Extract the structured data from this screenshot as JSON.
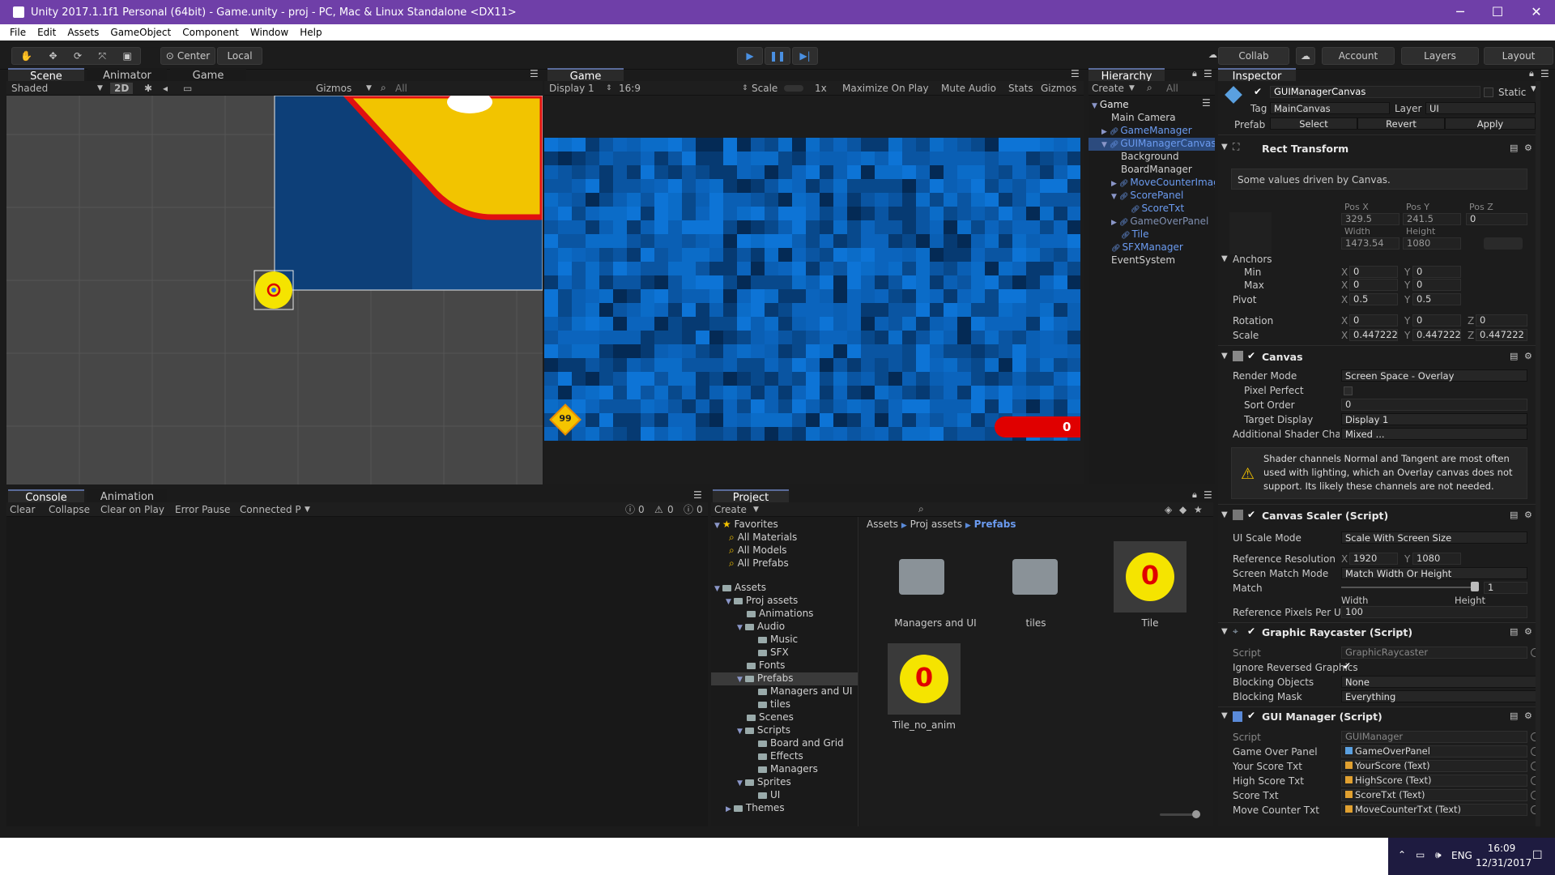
{
  "window": {
    "title": "Unity 2017.1.1f1 Personal (64bit) - Game.unity - proj - PC, Mac & Linux Standalone <DX11>",
    "minimize": "─",
    "maximize": "☐",
    "close": "✕"
  },
  "menu": [
    "File",
    "Edit",
    "Assets",
    "GameObject",
    "Component",
    "Window",
    "Help"
  ],
  "toolbar": {
    "tools": [
      "hand-icon",
      "move-icon",
      "rotate-icon",
      "scale-icon",
      "rect-icon"
    ],
    "center_label": "Center",
    "local_label": "Local",
    "play_controls": [
      "play-icon",
      "pause-icon",
      "step-icon"
    ],
    "collab_label": "Collab",
    "account_label": "Account",
    "layers_label": "Layers",
    "layout_label": "Layout"
  },
  "scene": {
    "tabs": [
      "Scene",
      "Animator",
      "Game"
    ],
    "shaded": "Shaded",
    "mode_2d": "2D",
    "gizmos": "Gizmos",
    "search_placeholder": "All"
  },
  "game": {
    "tab": "Game",
    "display": "Display 1",
    "aspect": "16:9",
    "scale_label": "Scale",
    "scale_value": "1x",
    "maximize": "Maximize On Play",
    "mute": "Mute Audio",
    "stats": "Stats",
    "gizmos": "Gizmos",
    "moves_counter": "99",
    "score": "0"
  },
  "hierarchy": {
    "tab": "Hierarchy",
    "create": "Create",
    "search_placeholder": "All",
    "items": [
      {
        "label": "Game",
        "indent": 0,
        "arrow": "▼",
        "prefab": false
      },
      {
        "label": "Main Camera",
        "indent": 1,
        "arrow": "",
        "prefab": false
      },
      {
        "label": "GameManager",
        "indent": 1,
        "arrow": "▶",
        "prefab": true
      },
      {
        "label": "GUIManagerCanvas",
        "indent": 1,
        "arrow": "▼",
        "prefab": true,
        "selected": true
      },
      {
        "label": "Background",
        "indent": 2,
        "arrow": "",
        "prefab": false
      },
      {
        "label": "BoardManager",
        "indent": 2,
        "arrow": "",
        "prefab": false
      },
      {
        "label": "MoveCounterImag",
        "indent": 2,
        "arrow": "▶",
        "prefab": true
      },
      {
        "label": "ScorePanel",
        "indent": 2,
        "arrow": "▼",
        "prefab": true
      },
      {
        "label": "ScoreTxt",
        "indent": 3,
        "arrow": "",
        "prefab": true
      },
      {
        "label": "GameOverPanel",
        "indent": 2,
        "arrow": "▶",
        "prefab": true,
        "dim": true
      },
      {
        "label": "Tile",
        "indent": 2,
        "arrow": "",
        "prefab": true
      },
      {
        "label": "SFXManager",
        "indent": 1,
        "arrow": "",
        "prefab": true
      },
      {
        "label": "EventSystem",
        "indent": 1,
        "arrow": "",
        "prefab": false
      }
    ]
  },
  "inspector": {
    "tab": "Inspector",
    "object_name": "GUIManagerCanvas",
    "static_label": "Static",
    "tag_label": "Tag",
    "tag_value": "MainCanvas",
    "layer_label": "Layer",
    "layer_value": "UI",
    "prefab_label": "Prefab",
    "prefab_select": "Select",
    "prefab_revert": "Revert",
    "prefab_apply": "Apply",
    "rect_transform": {
      "title": "Rect Transform",
      "note": "Some values driven by Canvas.",
      "pos_x_label": "Pos X",
      "pos_y_label": "Pos Y",
      "pos_z_label": "Pos Z",
      "pos_x": "329.5",
      "pos_y": "241.5",
      "pos_z": "0",
      "width_label": "Width",
      "height_label": "Height",
      "width": "1473.54",
      "height": "1080",
      "anchors_label": "Anchors",
      "min_label": "Min",
      "max_label": "Max",
      "min_x": "0",
      "min_y": "0",
      "max_x": "0",
      "max_y": "0",
      "pivot_label": "Pivot",
      "pivot_x": "0.5",
      "pivot_y": "0.5",
      "rotation_label": "Rotation",
      "rot_x": "0",
      "rot_y": "0",
      "rot_z": "0",
      "scale_label": "Scale",
      "scale_x": "0.447222",
      "scale_y": "0.447222",
      "scale_z": "0.447222"
    },
    "canvas": {
      "title": "Canvas",
      "render_mode_label": "Render Mode",
      "render_mode": "Screen Space - Overlay",
      "pixel_perfect_label": "Pixel Perfect",
      "sort_order_label": "Sort Order",
      "sort_order": "0",
      "target_display_label": "Target Display",
      "target_display": "Display 1",
      "shader_channels_label": "Additional Shader Chann",
      "shader_channels": "Mixed ...",
      "warning": "Shader channels Normal and Tangent are most often used with lighting, which an Overlay canvas does not support. Its likely these channels are not needed."
    },
    "canvas_scaler": {
      "title": "Canvas Scaler (Script)",
      "ui_scale_mode_label": "UI Scale Mode",
      "ui_scale_mode": "Scale With Screen Size",
      "ref_res_label": "Reference Resolution",
      "ref_x": "1920",
      "ref_y": "1080",
      "match_mode_label": "Screen Match Mode",
      "match_mode": "Match Width Or Height",
      "match_label": "Match",
      "match_value": "1",
      "match_fraction": 1.0,
      "width_label": "Width",
      "height_label": "Height",
      "ppu_label": "Reference Pixels Per Unit",
      "ppu": "100"
    },
    "graphic_raycaster": {
      "title": "Graphic Raycaster (Script)",
      "script_label": "Script",
      "script": "GraphicRaycaster",
      "ignore_label": "Ignore Reversed Graphics",
      "blocking_objects_label": "Blocking Objects",
      "blocking_objects": "None",
      "blocking_mask_label": "Blocking Mask",
      "blocking_mask": "Everything"
    },
    "gui_manager": {
      "title": "GUI Manager (Script)",
      "script_label": "Script",
      "script": "GUIManager",
      "fields": [
        {
          "label": "Game Over Panel",
          "value": "GameOverPanel"
        },
        {
          "label": "Your Score Txt",
          "value": "YourScore (Text)"
        },
        {
          "label": "High Score Txt",
          "value": "HighScore (Text)"
        },
        {
          "label": "Score Txt",
          "value": "ScoreTxt (Text)"
        },
        {
          "label": "Move Counter Txt",
          "value": "MoveCounterTxt (Text)"
        }
      ]
    }
  },
  "console": {
    "tabs": [
      "Console",
      "Animation"
    ],
    "buttons": [
      "Clear",
      "Collapse",
      "Clear on Play",
      "Error Pause",
      "Connected P"
    ],
    "info_count": "0",
    "warn_count": "0",
    "error_count": "0"
  },
  "project": {
    "tab": "Project",
    "create": "Create",
    "favorites_label": "Favorites",
    "favorites": [
      "All Materials",
      "All Models",
      "All Prefabs"
    ],
    "tree": [
      {
        "label": "Assets",
        "indent": 0,
        "arrow": "▼"
      },
      {
        "label": "Proj assets",
        "indent": 1,
        "arrow": "▼"
      },
      {
        "label": "Animations",
        "indent": 2,
        "arrow": ""
      },
      {
        "label": "Audio",
        "indent": 2,
        "arrow": "▼"
      },
      {
        "label": "Music",
        "indent": 3,
        "arrow": ""
      },
      {
        "label": "SFX",
        "indent": 3,
        "arrow": ""
      },
      {
        "label": "Fonts",
        "indent": 2,
        "arrow": ""
      },
      {
        "label": "Prefabs",
        "indent": 2,
        "arrow": "▼",
        "selected": true
      },
      {
        "label": "Managers and UI",
        "indent": 3,
        "arrow": ""
      },
      {
        "label": "tiles",
        "indent": 3,
        "arrow": ""
      },
      {
        "label": "Scenes",
        "indent": 2,
        "arrow": ""
      },
      {
        "label": "Scripts",
        "indent": 2,
        "arrow": "▼"
      },
      {
        "label": "Board and Grid",
        "indent": 3,
        "arrow": ""
      },
      {
        "label": "Effects",
        "indent": 3,
        "arrow": ""
      },
      {
        "label": "Managers",
        "indent": 3,
        "arrow": ""
      },
      {
        "label": "Sprites",
        "indent": 2,
        "arrow": "▼"
      },
      {
        "label": "UI",
        "indent": 3,
        "arrow": ""
      },
      {
        "label": "Themes",
        "indent": 1,
        "arrow": "▶"
      }
    ],
    "breadcrumb": [
      "Assets",
      "Proj assets",
      "Prefabs"
    ],
    "assets": [
      {
        "label": "Managers and UI",
        "kind": "folder"
      },
      {
        "label": "tiles",
        "kind": "folder"
      },
      {
        "label": "Tile",
        "kind": "tile",
        "text": "0"
      },
      {
        "label": "Tile_no_anim",
        "kind": "tile",
        "text": "0"
      }
    ]
  },
  "taskbar": {
    "lang": "ENG",
    "time": "16:09",
    "date": "12/31/2017"
  },
  "colors": {
    "titlebar": "#6f3fa8",
    "selection": "#2c4b7e",
    "prefab_blue": "#6b9bf0",
    "tile_yellow": "#f5e400",
    "tile_red": "#e00000"
  }
}
